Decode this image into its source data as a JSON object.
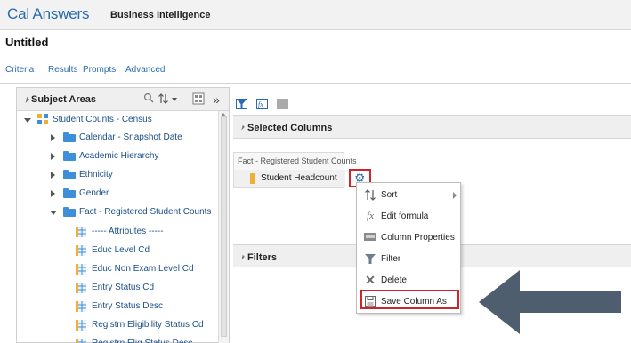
{
  "app": {
    "logo": "Cal Answers",
    "name": "Business Intelligence",
    "doc_title": "Untitled"
  },
  "tabs": [
    "Criteria",
    "Results",
    "Prompts",
    "Advanced"
  ],
  "subject_areas": {
    "title": "Subject Areas",
    "root": "Student Counts - Census",
    "items": [
      "Calendar - Snapshot Date",
      "Academic Hierarchy",
      "Ethnicity",
      "Gender",
      "Fact - Registered Student Counts"
    ],
    "children": [
      "----- Attributes -----",
      "Educ Level Cd",
      "Educ Non Exam Level Cd",
      "Entry Status Cd",
      "Entry Status Desc",
      "Registrn Eligibility Status Cd",
      "Registrn Elig Status Desc"
    ]
  },
  "selected_columns": {
    "title": "Selected Columns",
    "group": "Fact - Registered Student Counts",
    "column": "Student Headcount"
  },
  "filters": {
    "title": "Filters"
  },
  "context_menu": {
    "items": [
      {
        "label": "Sort",
        "icon": "sort-icon"
      },
      {
        "label": "Edit formula",
        "icon": "formula-icon"
      },
      {
        "label": "Column Properties",
        "icon": "column-properties-icon"
      },
      {
        "label": "Filter",
        "icon": "filter-icon"
      },
      {
        "label": "Delete",
        "icon": "delete-icon"
      },
      {
        "label": "Save Column As",
        "icon": "save-icon"
      }
    ]
  },
  "colors": {
    "accent": "#2a6bb0",
    "highlight": "#d0242c",
    "arrow": "#4f5e6f"
  }
}
